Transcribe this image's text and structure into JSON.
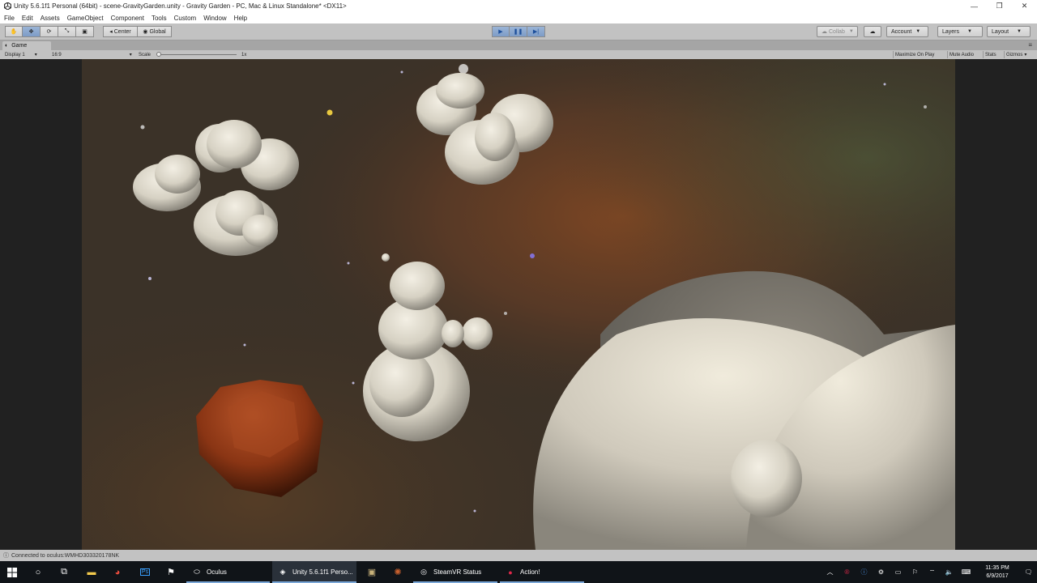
{
  "window": {
    "title": "Unity 5.6.1f1 Personal (64bit) - scene-GravityGarden.unity - Gravity Garden - PC, Mac & Linux Standalone* <DX11>",
    "minimize": "—",
    "maximize": "❐",
    "close": "✕"
  },
  "menu": [
    "File",
    "Edit",
    "Assets",
    "GameObject",
    "Component",
    "Tools",
    "Custom",
    "Window",
    "Help"
  ],
  "toolbar": {
    "pivot_label": "Center",
    "space_label": "Global",
    "collab_label": "Collab",
    "account_label": "Account",
    "layers_label": "Layers",
    "layout_label": "Layout"
  },
  "game_tab": {
    "label": "Game",
    "display_label": "Display 1",
    "aspect_label": "16:9",
    "scale_label": "Scale",
    "scale_value": "1x",
    "maximize_label": "Maximize On Play",
    "mute_label": "Mute Audio",
    "stats_label": "Stats",
    "gizmos_label": "Gizmos"
  },
  "status": {
    "message": "Connected to oculus:WMHD303320178NK"
  },
  "taskbar": {
    "apps": [
      {
        "label": "Oculus",
        "icon": "oculus-icon"
      },
      {
        "label": "Unity 5.6.1f1 Perso...",
        "icon": "unity-icon"
      },
      {
        "label": "SteamVR Status",
        "icon": "steamvr-icon"
      },
      {
        "label": "Action!",
        "icon": "action-record-icon"
      }
    ],
    "time": "11:35 PM",
    "date": "6/9/2017"
  },
  "colors": {
    "toolbar": "#c2c2c2",
    "play_active": "#7d9cc7",
    "taskbar": "#101418",
    "asteroid_white": "#dcd8cc",
    "asteroid_red": "#8a3514"
  }
}
